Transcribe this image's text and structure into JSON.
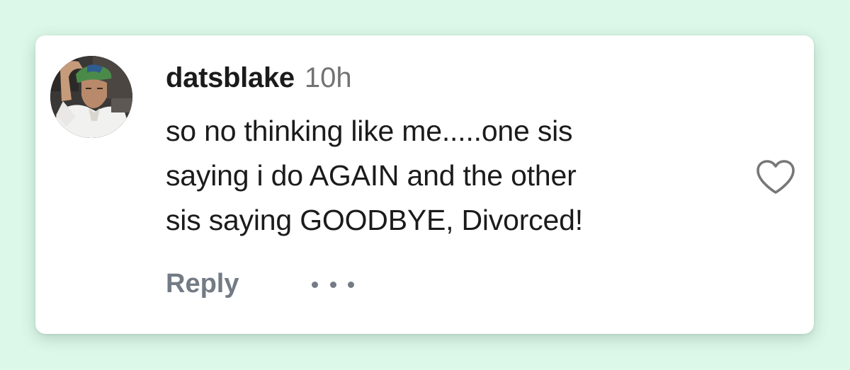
{
  "comment": {
    "username": "datsblake",
    "timestamp": "10h",
    "text_lines": [
      "so no thinking like me.....one sis",
      "saying i do AGAIN and the other",
      "sis saying GOODBYE, Divorced!"
    ],
    "like_icon": "heart-outline-icon",
    "reply_label": "Reply",
    "more_icon": "ellipsis-icon"
  },
  "colors": {
    "background": "#dcf8e9",
    "card": "#ffffff",
    "text": "#1b1b1b",
    "muted": "#737373",
    "action": "#737b85"
  }
}
